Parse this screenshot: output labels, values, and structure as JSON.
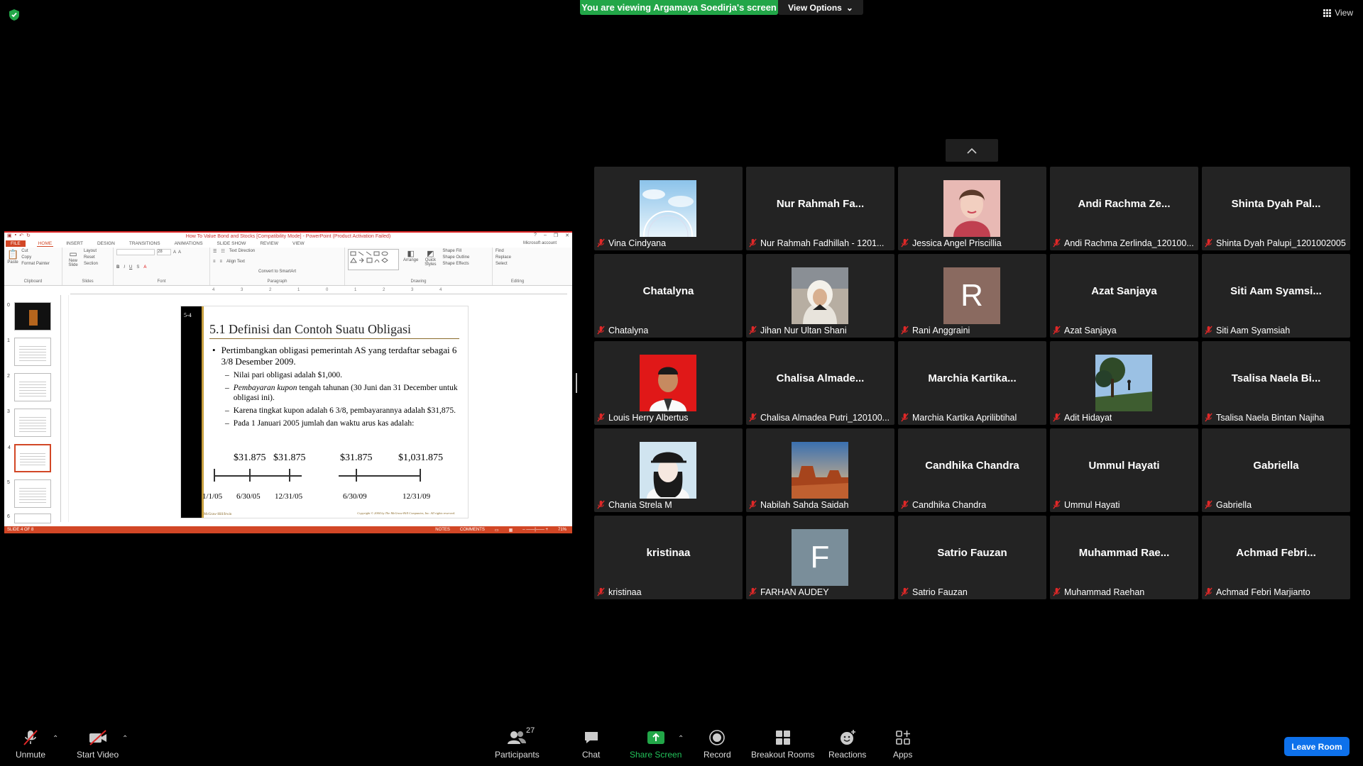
{
  "top": {
    "banner": "You are viewing Argamaya Soedirja's screen",
    "view_options": "View Options",
    "view": "View"
  },
  "ppt": {
    "window_title": "How To Value Bond and Stocks [Compatibility Mode] - PowerPoint (Product Activation Failed)",
    "tabs": [
      "FILE",
      "HOME",
      "INSERT",
      "DESIGN",
      "TRANSITIONS",
      "ANIMATIONS",
      "SLIDE SHOW",
      "REVIEW",
      "VIEW"
    ],
    "account": "Microsoft account",
    "ribbon": {
      "clipboard": {
        "name": "Clipboard",
        "paste": "Paste",
        "cut": "Cut",
        "copy": "Copy",
        "format_painter": "Format Painter"
      },
      "slides": {
        "name": "Slides",
        "new_slide": "New Slide",
        "layout": "Layout",
        "reset": "Reset",
        "section": "Section"
      },
      "font": {
        "name": "Font",
        "size": "28"
      },
      "paragraph": {
        "name": "Paragraph",
        "text_direction": "Text Direction",
        "align_text": "Align Text",
        "convert": "Convert to SmartArt"
      },
      "drawing": {
        "name": "Drawing",
        "arrange": "Arrange",
        "quick_styles": "Quick Styles",
        "shape_fill": "Shape Fill",
        "shape_outline": "Shape Outline",
        "shape_effects": "Shape Effects"
      },
      "editing": {
        "name": "Editing",
        "find": "Find",
        "replace": "Replace",
        "select": "Select"
      }
    },
    "thumb_numbers": [
      "0",
      "1",
      "2",
      "3",
      "4",
      "5",
      "6"
    ],
    "slide": {
      "number": "5-4",
      "title": "5.1   Definisi dan Contoh Suatu Obligasi",
      "bullet": "Pertimbangkan obligasi pemerintah AS yang terdaftar sebagai 6 3/8 Desember 2009.",
      "sub1": "Nilai pari obligasi adalah $1,000.",
      "sub2_em": "Pembayaran kupon",
      "sub2_rest": " tengah tahunan (30 Juni dan 31 December untuk obligasi ini).",
      "sub3": "Karena tingkat kupon adalah 6 3/8, pembayarannya adalah $31,875.",
      "sub4": "Pada 1 Januari 2005 jumlah dan waktu arus kas adalah:",
      "amounts": [
        "$31.875",
        "$31.875",
        "$31.875",
        "$1,031.875"
      ],
      "dates": [
        "1/1/05",
        "6/30/05",
        "12/31/05",
        "6/30/09",
        "12/31/09"
      ],
      "footer_left": "McGraw-Hill/Irwin",
      "footer_right": "Copyright © 2004 by The McGraw-Hill Companies, Inc. All rights reserved."
    },
    "status": {
      "slide": "SLIDE 4 OF 8",
      "notes": "NOTES",
      "comments": "COMMENTS",
      "zoom": "71%"
    }
  },
  "participants_tiles": [
    {
      "label": "Vina Cindyana",
      "display": "photo-sky"
    },
    {
      "label": "Nur Rahmah Fadhillah - 1201...",
      "display": "name",
      "big": "Nur Rahmah Fa..."
    },
    {
      "label": "Jessica Angel Priscillia",
      "display": "photo-pink"
    },
    {
      "label": "Andi Rachma Zerlinda_120100...",
      "display": "name",
      "big": "Andi Rachma Ze..."
    },
    {
      "label": "Shinta Dyah Palupi_1201002005",
      "display": "name",
      "big": "Shinta Dyah Pal..."
    },
    {
      "label": "Chatalyna",
      "display": "name",
      "big": "Chatalyna"
    },
    {
      "label": "Jihan Nur Ultan Shani",
      "display": "photo-hijab"
    },
    {
      "label": "Rani Anggraini",
      "display": "letter",
      "letter": "R",
      "color": "#8a6a60"
    },
    {
      "label": "Azat Sanjaya",
      "display": "name",
      "big": "Azat Sanjaya"
    },
    {
      "label": "Siti Aam Syamsiah",
      "display": "name",
      "big": "Siti Aam Syamsi..."
    },
    {
      "label": "Louis Herry Albertus",
      "display": "photo-red"
    },
    {
      "label": "Chalisa Almadea Putri_120100...",
      "display": "name",
      "big": "Chalisa  Almade..."
    },
    {
      "label": "Marchia Kartika Aprilibtihal",
      "display": "name",
      "big": "Marchia  Kartika..."
    },
    {
      "label": "Adit Hidayat",
      "display": "photo-tree"
    },
    {
      "label": "Tsalisa Naela Bintan Najiha",
      "display": "name",
      "big": "Tsalisa Naela Bi..."
    },
    {
      "label": "Chania Strela M",
      "display": "photo-anime"
    },
    {
      "label": "Nabilah Sahda Saidah",
      "display": "photo-desert"
    },
    {
      "label": "Candhika Chandra",
      "display": "name",
      "big": "Candhika Chandra"
    },
    {
      "label": "Ummul Hayati",
      "display": "name",
      "big": "Ummul Hayati"
    },
    {
      "label": "Gabriella",
      "display": "name",
      "big": "Gabriella"
    },
    {
      "label": "kristinaa",
      "display": "name",
      "big": "kristinaa"
    },
    {
      "label": "FARHAN AUDEY",
      "display": "letter",
      "letter": "F",
      "color": "#7a8e9a"
    },
    {
      "label": "Satrio Fauzan",
      "display": "name",
      "big": "Satrio Fauzan"
    },
    {
      "label": "Muhammad Raehan",
      "display": "name",
      "big": "Muhammad Rae..."
    },
    {
      "label": "Achmad Febri Marjianto",
      "display": "name",
      "big": "Achmad  Febri..."
    }
  ],
  "toolbar": {
    "unmute": "Unmute",
    "start_video": "Start Video",
    "participants": "Participants",
    "participants_count": "27",
    "chat": "Chat",
    "share_screen": "Share Screen",
    "record": "Record",
    "breakout_rooms": "Breakout Rooms",
    "reactions": "Reactions",
    "apps": "Apps",
    "leave": "Leave Room"
  },
  "colors": {
    "share_green": "#22a648",
    "leave_blue": "#0e71eb",
    "ppt_accent": "#d24726",
    "mic_red": "#e02828"
  }
}
